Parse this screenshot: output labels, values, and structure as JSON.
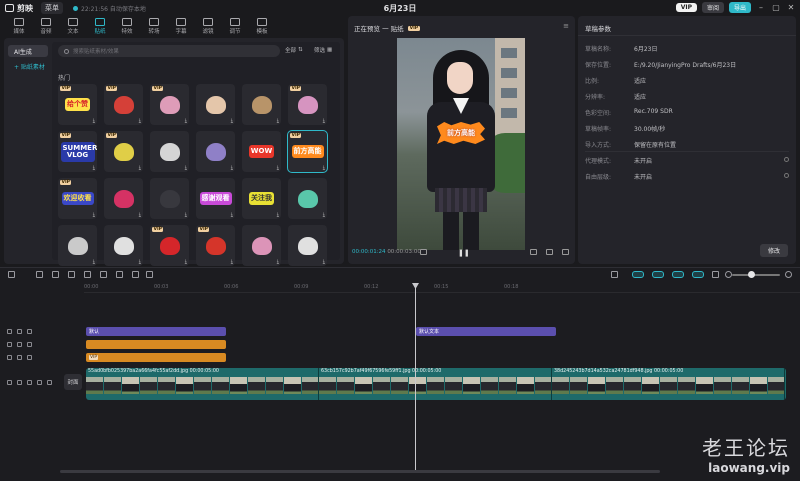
{
  "app": {
    "name": "剪映",
    "menu_label": "菜单",
    "autosave_text": "22:21:56 自动保存本地",
    "doc_title": "6月23日",
    "vip_label": "VIP",
    "share_label": "审阅",
    "export_label": "导出"
  },
  "toolbar": {
    "items": [
      {
        "label": "媒体",
        "icon": "media-icon"
      },
      {
        "label": "音频",
        "icon": "audio-icon"
      },
      {
        "label": "文本",
        "icon": "text-icon"
      },
      {
        "label": "贴纸",
        "icon": "sticker-icon",
        "active": true
      },
      {
        "label": "特效",
        "icon": "effects-icon"
      },
      {
        "label": "转场",
        "icon": "transition-icon"
      },
      {
        "label": "字幕",
        "icon": "caption-icon"
      },
      {
        "label": "滤镜",
        "icon": "filter-icon"
      },
      {
        "label": "调节",
        "icon": "adjust-icon"
      },
      {
        "label": "模板",
        "icon": "template-icon"
      }
    ]
  },
  "sticker_panel": {
    "categories": [
      {
        "label": "AI生成",
        "selected": true
      },
      {
        "label": "+ 贴纸素材",
        "selected": false
      }
    ],
    "search_placeholder": "搜索贴纸素材/效果",
    "filter_all": "全部",
    "filter_sort": "筛选",
    "section": "热门",
    "stickers": [
      {
        "name": "sticker-gei-ge-zan",
        "text": "给个赞",
        "vip": true,
        "color": "#ffe14a",
        "fg": "#d8232a"
      },
      {
        "name": "sticker-strawberry",
        "text": "",
        "vip": true,
        "color": "#e8433a",
        "fg": "#fff"
      },
      {
        "name": "sticker-pink-text",
        "text": "",
        "vip": true,
        "color": "#f2a8c8",
        "fg": "#fff"
      },
      {
        "name": "sticker-glow-heart",
        "text": "",
        "vip": false,
        "color": "#f8d7b8",
        "fg": "#fff"
      },
      {
        "name": "sticker-bear",
        "text": "",
        "vip": false,
        "color": "#c8a070",
        "fg": "#fff"
      },
      {
        "name": "sticker-gradient-box",
        "text": "",
        "vip": true,
        "color": "#e9a0d0",
        "fg": "#fff"
      },
      {
        "name": "sticker-summer-vlog",
        "text": "SUMMER VLOG",
        "vip": true,
        "color": "#2a3aa8",
        "fg": "#fff"
      },
      {
        "name": "sticker-quote",
        "text": "",
        "vip": true,
        "color": "#f4e04a",
        "fg": "#333"
      },
      {
        "name": "sticker-butterfly-white",
        "text": "",
        "vip": false,
        "color": "#e8e8e8",
        "fg": "#fff"
      },
      {
        "name": "sticker-feather",
        "text": "",
        "vip": false,
        "color": "#9a8ad8",
        "fg": "#fff"
      },
      {
        "name": "sticker-wow",
        "text": "WOW",
        "vip": false,
        "color": "#e8362a",
        "fg": "#fff"
      },
      {
        "name": "sticker-qian-fang-gao-neng",
        "text": "前方高能",
        "vip": true,
        "color": "#ff8a1d",
        "fg": "#fff",
        "selected": true
      },
      {
        "name": "sticker-huan-ying-shou-kan",
        "text": "欢迎收看",
        "vip": true,
        "color": "#3a48c8",
        "fg": "#ffe14a"
      },
      {
        "name": "sticker-pink-heart",
        "text": "",
        "vip": false,
        "color": "#e8336a",
        "fg": "#fff"
      },
      {
        "name": "sticker-dark-dots",
        "text": "",
        "vip": false,
        "color": "#3a3a40",
        "fg": "#fff"
      },
      {
        "name": "sticker-thanks-watching",
        "text": "感谢观看",
        "vip": false,
        "color": "#c84ad8",
        "fg": "#fff"
      },
      {
        "name": "sticker-yellow-badge",
        "text": "关注我",
        "vip": false,
        "color": "#e8e034",
        "fg": "#333"
      },
      {
        "name": "sticker-cyan-butterfly",
        "text": "",
        "vip": false,
        "color": "#5ed8b8",
        "fg": "#fff"
      },
      {
        "name": "sticker-sparkle",
        "text": "",
        "vip": false,
        "color": "#dcdcdc",
        "fg": "#fff"
      },
      {
        "name": "sticker-cloud",
        "text": "",
        "vip": false,
        "color": "#f4f4f4",
        "fg": "#333"
      },
      {
        "name": "sticker-red-arrow-down",
        "text": "",
        "vip": true,
        "color": "#e8262a",
        "fg": "#fff"
      },
      {
        "name": "sticker-red-cursor",
        "text": "",
        "vip": true,
        "color": "#e8362a",
        "fg": "#fff"
      },
      {
        "name": "sticker-pink-glossy-heart",
        "text": "",
        "vip": false,
        "color": "#f0a0c8",
        "fg": "#fff"
      },
      {
        "name": "sticker-white-sparkles",
        "text": "",
        "vip": false,
        "color": "#f4f4f4",
        "fg": "#fff"
      }
    ]
  },
  "player": {
    "title": "正在预览 一 贴纸",
    "vip_tag": "VIP",
    "overlay_text": "前方高能",
    "current_time": "00:00:01:24",
    "duration": "00:00:03:00"
  },
  "properties": {
    "title": "草稿参数",
    "rows": [
      {
        "label": "草稿名称:",
        "value": "6月23日"
      },
      {
        "label": "保存位置:",
        "value": "E:/9.20/JianyingPro Drafts/6月23日"
      },
      {
        "label": "比例:",
        "value": "适应"
      },
      {
        "label": "分辨率:",
        "value": "适应"
      },
      {
        "label": "色彩空间:",
        "value": "Rec.709 SDR"
      },
      {
        "label": "草稿帧率:",
        "value": "30.00帧/秒"
      },
      {
        "label": "导入方式:",
        "value": "保留在原有位置"
      }
    ],
    "rows2": [
      {
        "label": "代理模式:",
        "value": "未开启"
      },
      {
        "label": "自由层级:",
        "value": "未开启"
      }
    ],
    "modify_label": "修改"
  },
  "timeline": {
    "ticks": [
      "00:00",
      "00:03",
      "00:06",
      "00:09",
      "00:12",
      "00:15",
      "00:18"
    ],
    "text_clips": [
      {
        "label": "默认",
        "track": 0,
        "start": 0.0,
        "end": 0.2
      },
      {
        "label": "默认文本",
        "track": 0,
        "start": 0.47,
        "end": 0.67
      }
    ],
    "sticker_clips": [
      {
        "label": "",
        "track": 1
      },
      {
        "label": "VIP",
        "track": 2
      }
    ],
    "cover_label": "封面",
    "video_clips": [
      {
        "label": "55ad0bfb025397ba2a66fa4fc55af2dd.jpg  00:00:05:00"
      },
      {
        "label": "63cb157c92b7af49f67596fe59ff1.jpg  00:00:05:00"
      },
      {
        "label": "38d245243b7d14a532ca24781df948.jpg  00:00:05:00"
      }
    ]
  },
  "watermark": {
    "cn": "老王论坛",
    "en": "laowang.vip"
  }
}
